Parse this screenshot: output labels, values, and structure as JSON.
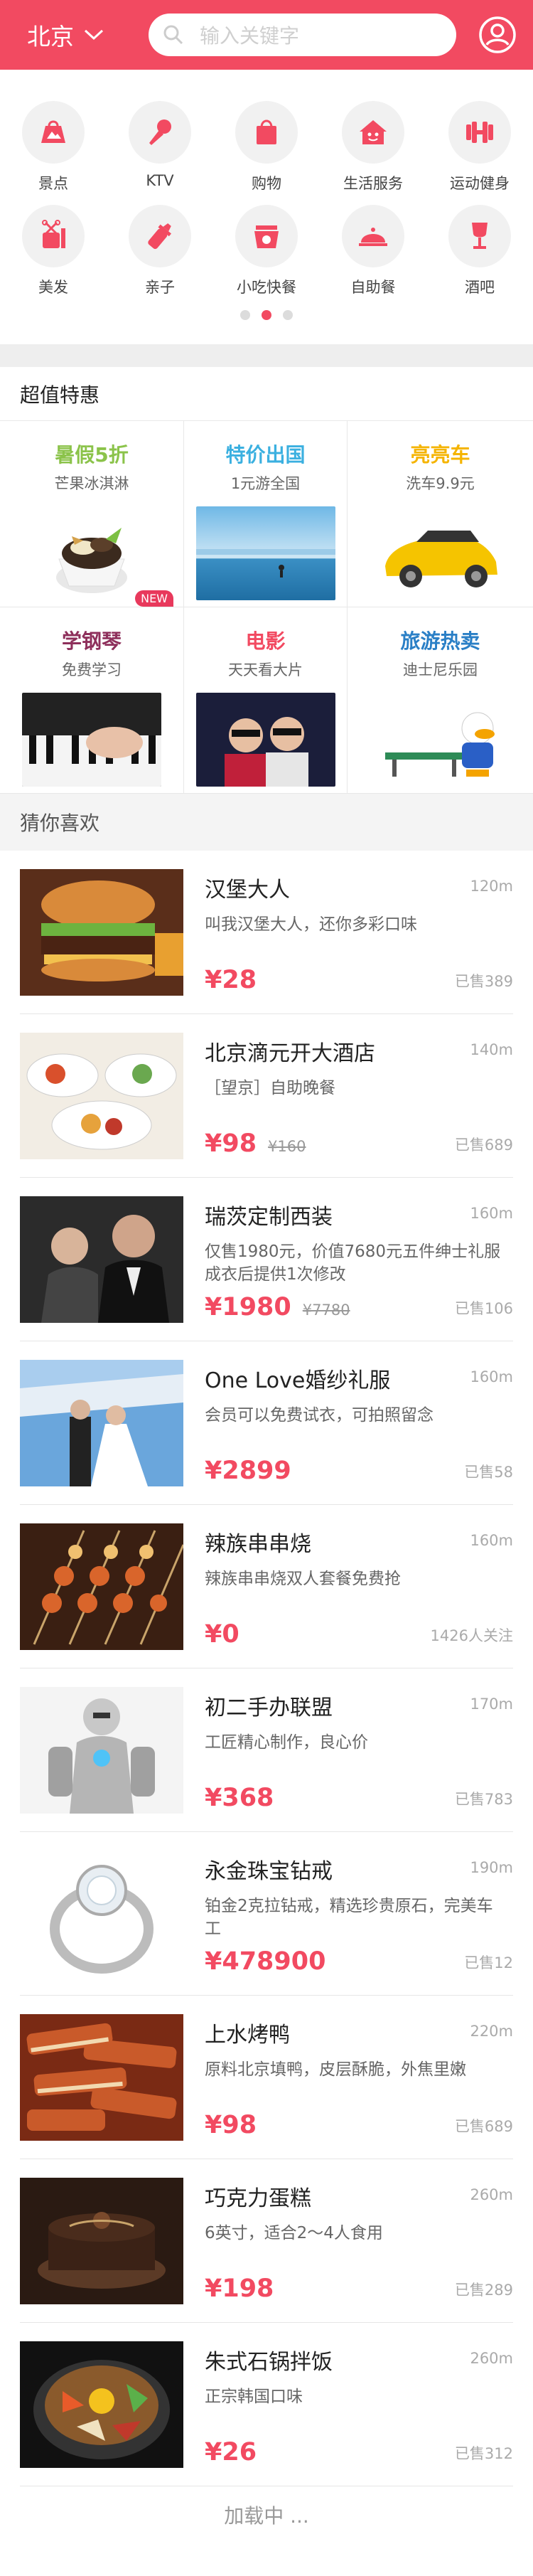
{
  "header": {
    "city": "北京",
    "search_placeholder": "输入关键字"
  },
  "colors": {
    "brand": "#f24a61",
    "price": "#f24a61"
  },
  "categories": [
    {
      "label": "景点",
      "icon": "mountain-bag-icon"
    },
    {
      "label": "KTV",
      "icon": "microphone-icon"
    },
    {
      "label": "购物",
      "icon": "shopping-bag-icon"
    },
    {
      "label": "生活服务",
      "icon": "house-icon"
    },
    {
      "label": "运动健身",
      "icon": "dumbbell-icon"
    },
    {
      "label": "美发",
      "icon": "scissors-comb-icon"
    },
    {
      "label": "亲子",
      "icon": "baby-bottle-icon"
    },
    {
      "label": "小吃快餐",
      "icon": "snack-icon"
    },
    {
      "label": "自助餐",
      "icon": "food-cloche-icon"
    },
    {
      "label": "酒吧",
      "icon": "wine-glass-icon"
    }
  ],
  "pager": {
    "count": 3,
    "active": 1
  },
  "deals_title": "超值特惠",
  "deals": [
    {
      "title": "暑假5折",
      "subtitle": "芒果冰淇淋",
      "color": "#8bc34a",
      "badge": "NEW"
    },
    {
      "title": "特价出国",
      "subtitle": "1元游全国",
      "color": "#3bb0e0"
    },
    {
      "title": "亮亮车",
      "subtitle": "洗车9.9元",
      "color": "#f5b400"
    },
    {
      "title": "学钢琴",
      "subtitle": "免费学习",
      "color": "#8e2f5b"
    },
    {
      "title": "电影",
      "subtitle": "天天看大片",
      "color": "#f24a61"
    },
    {
      "title": "旅游热卖",
      "subtitle": "迪士尼乐园",
      "color": "#2a7fc6"
    }
  ],
  "guess_title": "猜你喜欢",
  "items": [
    {
      "name": "汉堡大人",
      "desc": "叫我汉堡大人，还你多彩口味",
      "distance": "120m",
      "price": "¥28",
      "orig": "",
      "sold": "已售389"
    },
    {
      "name": "北京滴元开大酒店",
      "desc": "［望京］自助晚餐",
      "distance": "140m",
      "price": "¥98",
      "orig": "¥160",
      "sold": "已售689"
    },
    {
      "name": "瑞茨定制西装",
      "desc": "仅售1980元，价值7680元五件绅士礼服成衣后提供1次修改",
      "distance": "160m",
      "price": "¥1980",
      "orig": "¥7780",
      "sold": "已售106"
    },
    {
      "name": "One Love婚纱礼服",
      "desc": "会员可以免费试衣，可拍照留念",
      "distance": "160m",
      "price": "¥2899",
      "orig": "",
      "sold": "已售58"
    },
    {
      "name": "辣族串串烧",
      "desc": "辣族串串烧双人套餐免费抢",
      "distance": "160m",
      "price": "¥0",
      "orig": "",
      "sold": "1426人关注"
    },
    {
      "name": "初二手办联盟",
      "desc": "工匠精心制作，良心价",
      "distance": "170m",
      "price": "¥368",
      "orig": "",
      "sold": "已售783"
    },
    {
      "name": "永金珠宝钻戒",
      "desc": "铂金2克拉钻戒，精选珍贵原石，完美车工",
      "distance": "190m",
      "price": "¥478900",
      "orig": "",
      "sold": "已售12"
    },
    {
      "name": "上水烤鸭",
      "desc": "原料北京填鸭，皮层酥脆，外焦里嫩",
      "distance": "220m",
      "price": "¥98",
      "orig": "",
      "sold": "已售689"
    },
    {
      "name": "巧克力蛋糕",
      "desc": "6英寸，适合2～4人食用",
      "distance": "260m",
      "price": "¥198",
      "orig": "",
      "sold": "已售289"
    },
    {
      "name": "朱式石锅拌饭",
      "desc": "正宗韩国口味",
      "distance": "260m",
      "price": "¥26",
      "orig": "",
      "sold": "已售312"
    }
  ],
  "loading": "加载中 ..."
}
